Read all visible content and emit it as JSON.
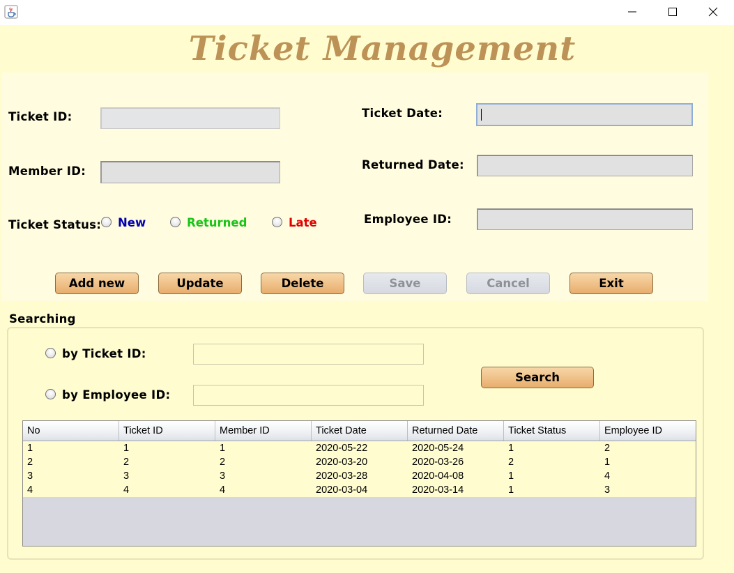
{
  "window": {
    "title": "",
    "controls": [
      "minimize-icon",
      "maximize-icon",
      "close-icon"
    ]
  },
  "heading": "Ticket Management",
  "form": {
    "ticket_id_label": "Ticket ID:",
    "ticket_id_value": "",
    "member_id_label": "Member ID:",
    "member_id_value": "",
    "ticket_status_label": "Ticket Status:",
    "status_options": [
      {
        "label": "New",
        "color": "#0000b0",
        "selected": false
      },
      {
        "label": "Returned",
        "color": "#18c418",
        "selected": false
      },
      {
        "label": "Late",
        "color": "#e00000",
        "selected": false
      }
    ],
    "ticket_date_label": "Ticket Date:",
    "ticket_date_value": "",
    "returned_date_label": "Returned Date:",
    "returned_date_value": "",
    "employee_id_label": "Employee ID:",
    "employee_id_value": ""
  },
  "buttons": {
    "add_new": "Add new",
    "update": "Update",
    "delete": "Delete",
    "save": "Save",
    "cancel": "Cancel",
    "exit": "Exit"
  },
  "search": {
    "title": "Searching",
    "by_ticket_id_label": "by Ticket ID:",
    "by_ticket_id_value": "",
    "by_employee_id_label": "by Employee ID:",
    "by_employee_id_value": "",
    "search_button": "Search"
  },
  "table": {
    "columns": [
      "No",
      "Ticket ID",
      "Member ID",
      "Ticket Date",
      "Returned Date",
      "Ticket Status",
      "Employee ID"
    ],
    "rows": [
      [
        "1",
        "1",
        "1",
        "2020-05-22",
        "2020-05-24",
        "1",
        "2"
      ],
      [
        "2",
        "2",
        "2",
        "2020-03-20",
        "2020-03-26",
        "2",
        "1"
      ],
      [
        "3",
        "3",
        "3",
        "2020-03-28",
        "2020-04-08",
        "1",
        "4"
      ],
      [
        "4",
        "4",
        "4",
        "2020-03-04",
        "2020-03-14",
        "1",
        "3"
      ]
    ]
  },
  "colors": {
    "background": "#fffdd0",
    "heading": "#bd9256",
    "button": "#e8ad6d"
  }
}
